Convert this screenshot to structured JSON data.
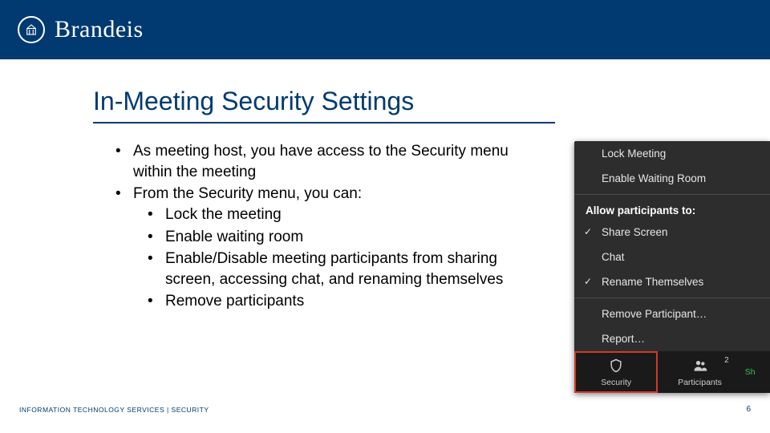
{
  "brand": "Brandeis",
  "title": "In-Meeting Security Settings",
  "bullets": {
    "b1": "As meeting host, you have access to the Security menu within the meeting",
    "b2": "From the Security menu, you can:",
    "s1": "Lock the meeting",
    "s2": "Enable waiting room",
    "s3": "Enable/Disable meeting participants from sharing screen, accessing chat, and renaming themselves",
    "s4": "Remove participants"
  },
  "zoom": {
    "lock": "Lock Meeting",
    "waiting": "Enable Waiting Room",
    "allow_header": "Allow participants to:",
    "share": "Share Screen",
    "chat": "Chat",
    "rename": "Rename Themselves",
    "remove": "Remove Participant…",
    "report": "Report…",
    "btn_security": "Security",
    "btn_participants": "Participants",
    "btn_share": "Sh",
    "participant_count": "2"
  },
  "footer": {
    "left": "INFORMATION TECHNOLOGY SERVICES | SECURITY",
    "page": "6"
  }
}
